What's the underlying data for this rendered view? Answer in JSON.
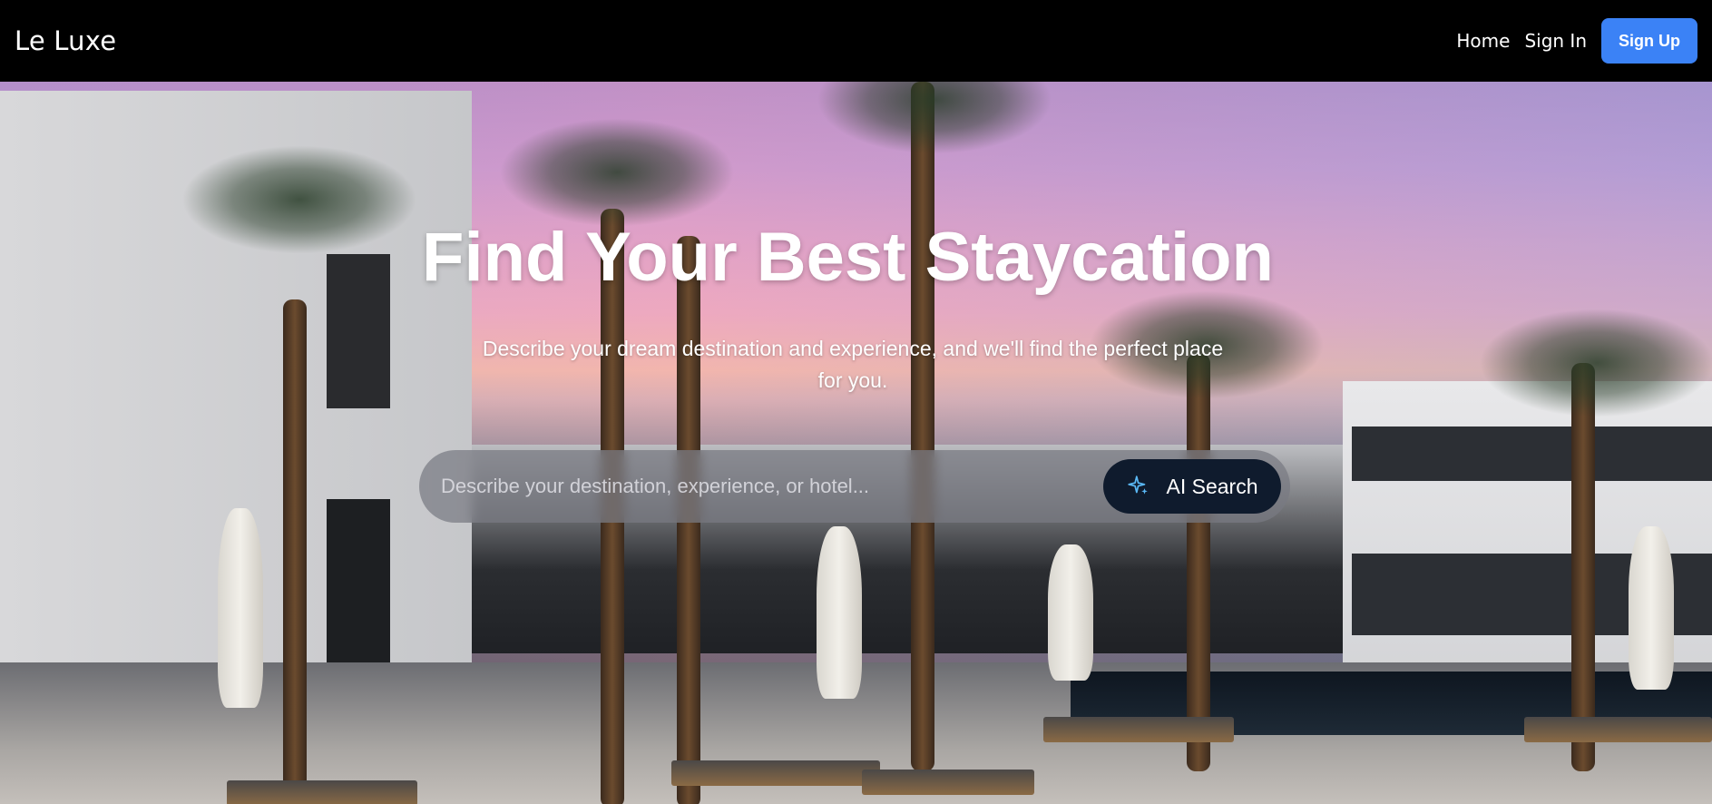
{
  "navbar": {
    "brand": "Le Luxe",
    "links": [
      "Home",
      "Sign In"
    ],
    "signup_label": "Sign Up",
    "signup_color": "#3b82f6"
  },
  "hero": {
    "title": "Find Your Best Staycation",
    "subtitle": "Describe your dream destination and experience, and we'll find the perfect place for you.",
    "search": {
      "placeholder": "Describe your destination, experience, or hotel...",
      "value": "",
      "button_label": "AI Search",
      "button_icon": "sparkle-icon",
      "button_color": "#0f1b2d"
    },
    "background_image": "resort-pool-palm-trees-at-sunset"
  }
}
